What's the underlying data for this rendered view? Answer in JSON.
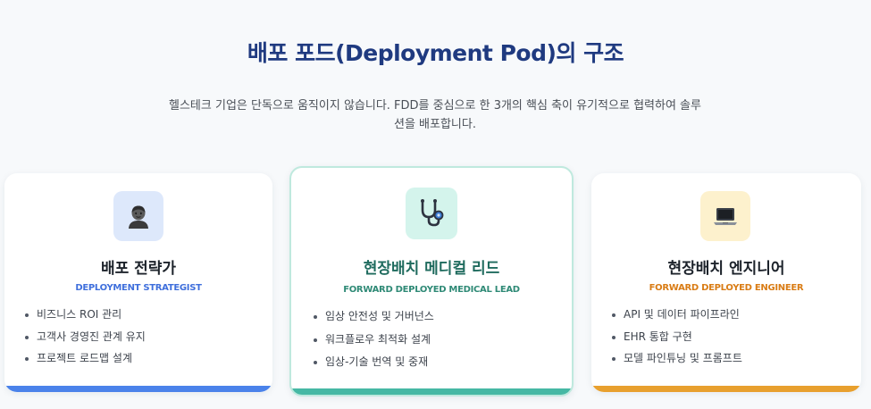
{
  "header": {
    "title": "배포 포드(Deployment Pod)의 구조",
    "subtitle": "헬스테크 기업은 단독으로 움직이지 않습니다. FDD를 중심으로 한 3개의 핵심 축이 유기적으로 협력하여 솔루션을 배포합니다."
  },
  "cards": [
    {
      "icon": "person-icon",
      "title": "배포 전략가",
      "subtitle": "DEPLOYMENT STRATEGIST",
      "accent": "#4a82ea",
      "icon_bg": "#dde8fb",
      "points": [
        "비즈니스 ROI 관리",
        "고객사 경영진 관계 유지",
        "프로젝트 로드맵 설계"
      ]
    },
    {
      "icon": "stethoscope-icon",
      "title": "현장배치 메디컬 리드",
      "subtitle": "FORWARD DEPLOYED MEDICAL LEAD",
      "accent": "#46b8a4",
      "icon_bg": "#d4f4ec",
      "points": [
        "임상 안전성 및 거버넌스",
        "워크플로우 최적화 설계",
        "임상-기술 번역 및 중재"
      ]
    },
    {
      "icon": "laptop-icon",
      "title": "현장배치 엔지니어",
      "subtitle": "FORWARD DEPLOYED ENGINEER",
      "accent": "#e8a02e",
      "icon_bg": "#fdf1cd",
      "points": [
        "API 및 데이터 파이프라인",
        "EHR 통합 구현",
        "모델 파인튜닝 및 프롬프트"
      ]
    }
  ]
}
